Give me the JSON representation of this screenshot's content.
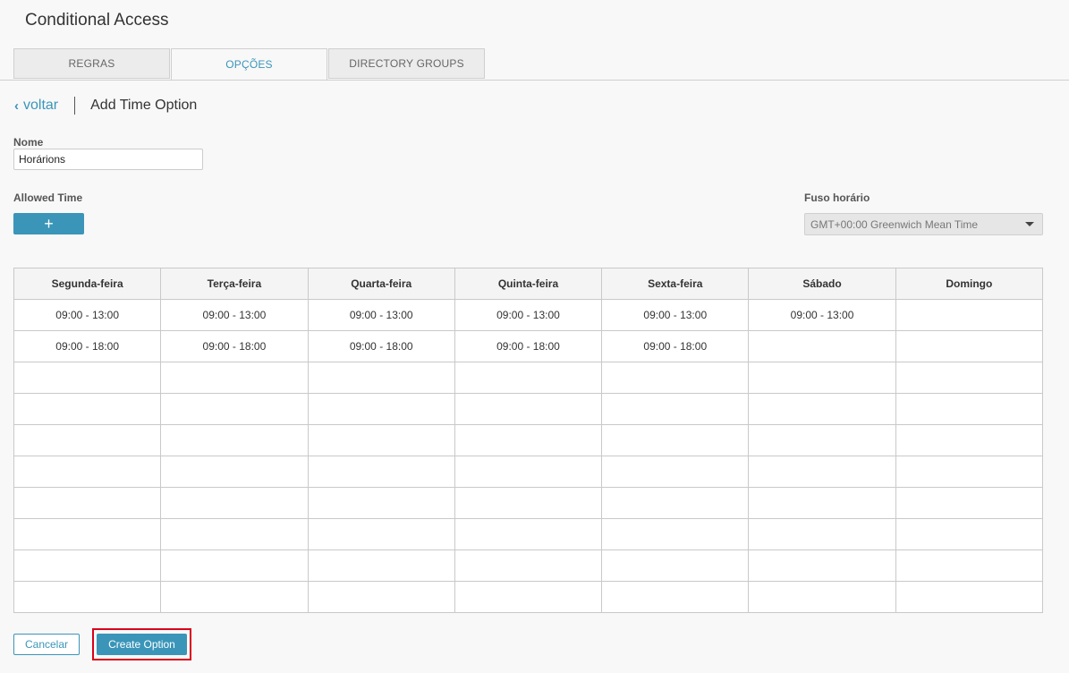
{
  "app": {
    "title": "Conditional Access"
  },
  "tabs": [
    {
      "label": "REGRAS",
      "active": false
    },
    {
      "label": "OPÇÕES",
      "active": true
    },
    {
      "label": "DIRECTORY GROUPS",
      "active": false
    }
  ],
  "nav": {
    "back_label": "voltar",
    "page_title": "Add Time Option"
  },
  "form": {
    "name_label": "Nome",
    "name_value": "Horárions",
    "allowed_time_label": "Allowed Time",
    "add_button_label": "+",
    "timezone_label": "Fuso horário",
    "timezone_value": "GMT+00:00 Greenwich Mean Time"
  },
  "schedule": {
    "headers": [
      "Segunda-feira",
      "Terça-feira",
      "Quarta-feira",
      "Quinta-feira",
      "Sexta-feira",
      "Sábado",
      "Domingo"
    ],
    "rows": [
      [
        "09:00 - 13:00",
        "09:00 - 13:00",
        "09:00 - 13:00",
        "09:00 - 13:00",
        "09:00 - 13:00",
        "09:00 - 13:00",
        ""
      ],
      [
        "09:00 - 18:00",
        "09:00 - 18:00",
        "09:00 - 18:00",
        "09:00 - 18:00",
        "09:00 - 18:00",
        "",
        ""
      ],
      [
        "",
        "",
        "",
        "",
        "",
        "",
        ""
      ],
      [
        "",
        "",
        "",
        "",
        "",
        "",
        ""
      ],
      [
        "",
        "",
        "",
        "",
        "",
        "",
        ""
      ],
      [
        "",
        "",
        "",
        "",
        "",
        "",
        ""
      ],
      [
        "",
        "",
        "",
        "",
        "",
        "",
        ""
      ],
      [
        "",
        "",
        "",
        "",
        "",
        "",
        ""
      ],
      [
        "",
        "",
        "",
        "",
        "",
        "",
        ""
      ],
      [
        "",
        "",
        "",
        "",
        "",
        "",
        ""
      ]
    ]
  },
  "actions": {
    "cancel_label": "Cancelar",
    "create_label": "Create Option"
  },
  "colors": {
    "accent": "#3a95b9",
    "highlight": "#d9001b"
  }
}
